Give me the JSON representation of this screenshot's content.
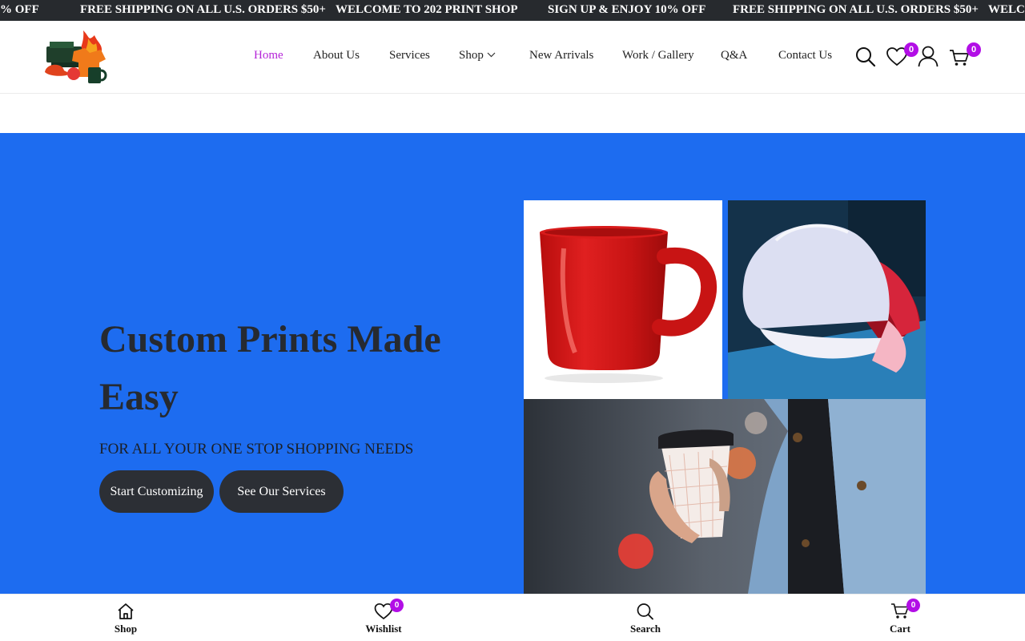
{
  "announcement": {
    "messages": [
      "% OFF",
      "FREE SHIPPING ON ALL U.S. ORDERS $50+",
      "WELCOME TO 202 PRINT SHOP",
      "SIGN UP & ENJOY 10% OFF",
      "FREE SHIPPING ON ALL U.S. ORDERS $50+",
      "WELCO"
    ]
  },
  "nav": {
    "items": [
      {
        "label": "Home",
        "active": true
      },
      {
        "label": "About Us"
      },
      {
        "label": "Services"
      },
      {
        "label": "Shop",
        "dropdown": true
      },
      {
        "label": "New Arrivals"
      },
      {
        "label": "Work / Gallery"
      },
      {
        "label": "Q&A"
      },
      {
        "label": "Contact Us"
      }
    ]
  },
  "header_icons": {
    "wishlist_count": "0",
    "cart_count": "0"
  },
  "hero": {
    "title": "Custom Prints Made Easy",
    "subtitle": "FOR ALL YOUR ONE STOP SHOPPING NEEDS",
    "primary_button": "Start Customizing",
    "secondary_button": "See Our Services"
  },
  "tabbar": {
    "items": [
      {
        "label": "Shop",
        "icon": "home-icon"
      },
      {
        "label": "Wishlist",
        "icon": "heart-icon",
        "count": "0"
      },
      {
        "label": "Search",
        "icon": "search-icon"
      },
      {
        "label": "Cart",
        "icon": "cart-icon",
        "count": "0"
      }
    ]
  },
  "colors": {
    "accent": "#b524d8",
    "badge": "#b20ee6",
    "hero_bg": "#1d6cf0",
    "button_bg": "#2c2f35",
    "topbar_bg": "#272a2e"
  }
}
